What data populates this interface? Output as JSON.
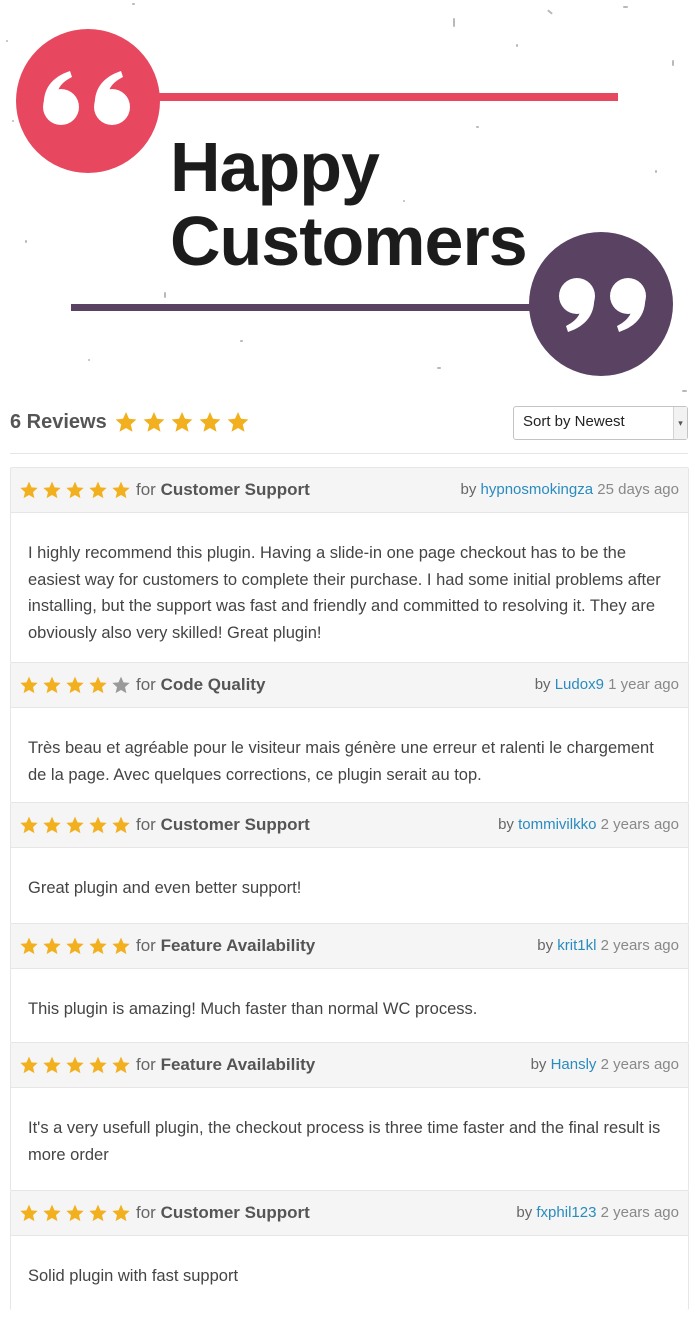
{
  "hero": {
    "title_line1": "Happy",
    "title_line2": "Customers",
    "accent_color": "#e8485f",
    "secondary_color": "#5a4263"
  },
  "summary": {
    "count_label": "6 Reviews",
    "rating": 5,
    "sort_value": "Sort by Newest"
  },
  "colors": {
    "star_filled": "#f2b01e",
    "star_empty": "#9a9a9a",
    "link": "#2a8bbf"
  },
  "reviews": [
    {
      "rating": 5,
      "for_label": "for",
      "category": "Customer Support",
      "by_label": "by",
      "author": "hypnosmokingza",
      "date": "25 days ago",
      "text": "I highly recommend this plugin. Having a slide-in one page checkout has to be the easiest way for customers to complete their purchase. I had some initial problems after installing, but the support was fast and friendly and committed to resolving it. They are obviously also very skilled! Great plugin!"
    },
    {
      "rating": 4,
      "for_label": "for",
      "category": "Code Quality",
      "by_label": "by",
      "author": "Ludox9",
      "date": "1 year ago",
      "text": "Très beau et agréable pour le visiteur mais génère une erreur et ralenti le chargement de la page. Avec quelques corrections, ce plugin serait au top."
    },
    {
      "rating": 5,
      "for_label": "for",
      "category": "Customer Support",
      "by_label": "by",
      "author": "tommivilkko",
      "date": "2 years ago",
      "text": "Great plugin and even better support!"
    },
    {
      "rating": 5,
      "for_label": "for",
      "category": "Feature Availability",
      "by_label": "by",
      "author": "krit1kl",
      "date": "2 years ago",
      "text": "This plugin is amazing! Much faster than normal WC process."
    },
    {
      "rating": 5,
      "for_label": "for",
      "category": "Feature Availability",
      "by_label": "by",
      "author": "Hansly",
      "date": "2 years ago",
      "text": "It's a very usefull plugin, the checkout process is three time faster and the final result is more order"
    },
    {
      "rating": 5,
      "for_label": "for",
      "category": "Customer Support",
      "by_label": "by",
      "author": "fxphil123",
      "date": "2 years ago",
      "text": "Solid plugin with fast support"
    }
  ]
}
